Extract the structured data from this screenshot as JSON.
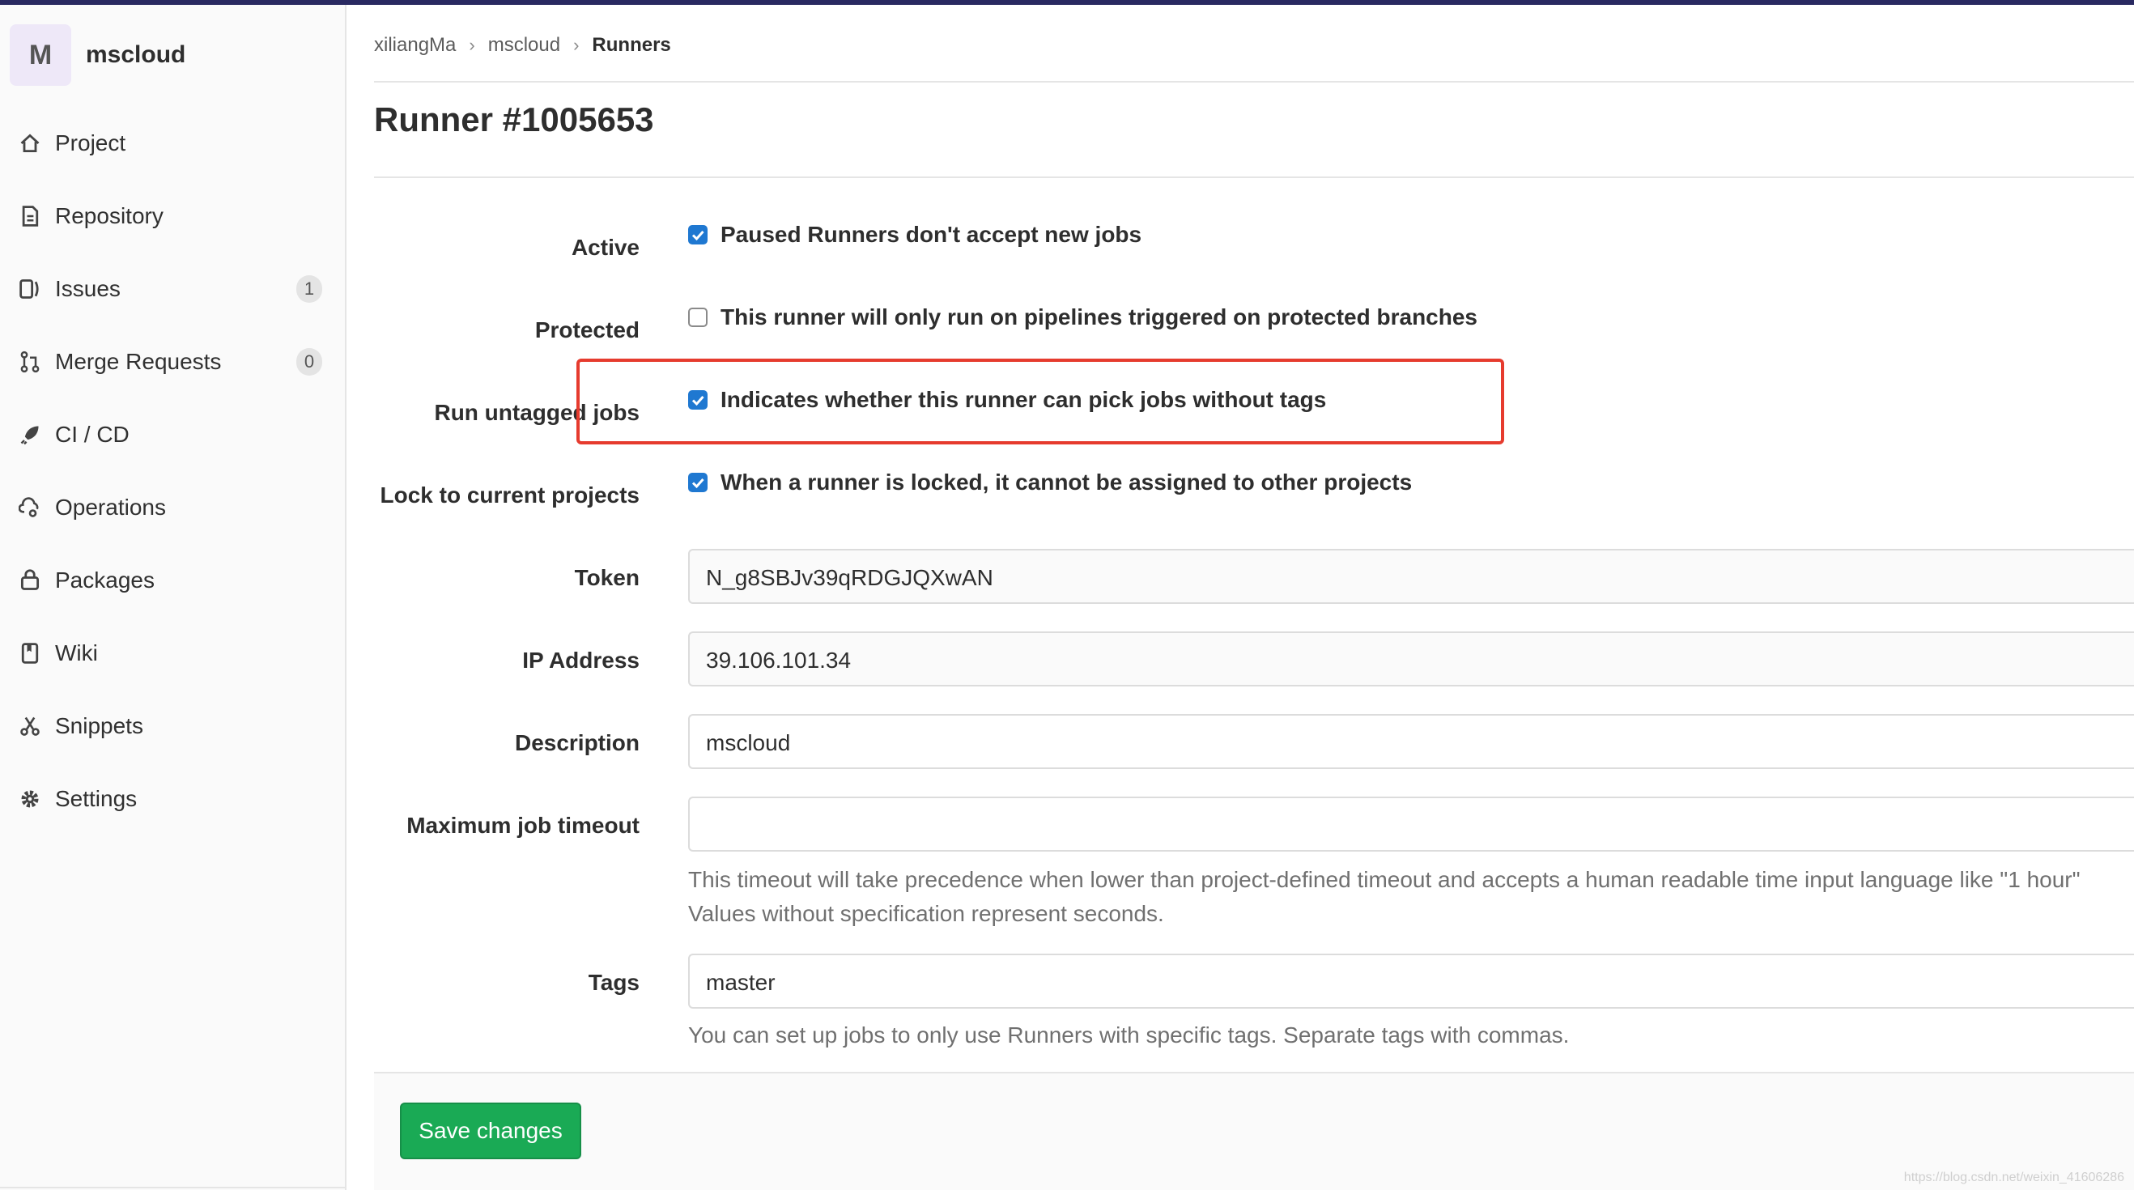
{
  "sidebar": {
    "avatar_letter": "M",
    "project_name": "mscloud",
    "items": [
      {
        "label": "Project",
        "icon": "home-icon"
      },
      {
        "label": "Repository",
        "icon": "doc-icon"
      },
      {
        "label": "Issues",
        "icon": "issues-icon",
        "badge": "1"
      },
      {
        "label": "Merge Requests",
        "icon": "merge-icon",
        "badge": "0"
      },
      {
        "label": "CI / CD",
        "icon": "rocket-icon"
      },
      {
        "label": "Operations",
        "icon": "cloud-gear-icon"
      },
      {
        "label": "Packages",
        "icon": "package-icon"
      },
      {
        "label": "Wiki",
        "icon": "book-icon"
      },
      {
        "label": "Snippets",
        "icon": "scissors-icon"
      },
      {
        "label": "Settings",
        "icon": "gear-icon"
      }
    ]
  },
  "breadcrumb": {
    "items": [
      "xiliangMa",
      "mscloud",
      "Runners"
    ],
    "separator": "›"
  },
  "page": {
    "title": "Runner #1005653"
  },
  "form": {
    "active": {
      "label": "Active",
      "text": "Paused Runners don't accept new jobs",
      "checked": true
    },
    "protected": {
      "label": "Protected",
      "text": "This runner will only run on pipelines triggered on protected branches",
      "checked": false
    },
    "run_untagged": {
      "label": "Run untagged jobs",
      "text": "Indicates whether this runner can pick jobs without tags",
      "checked": true
    },
    "lock": {
      "label": "Lock to current projects",
      "text": "When a runner is locked, it cannot be assigned to other projects",
      "checked": true
    },
    "token": {
      "label": "Token",
      "value": "N_g8SBJv39qRDGJQXwAN"
    },
    "ip": {
      "label": "IP Address",
      "value": "39.106.101.34"
    },
    "description": {
      "label": "Description",
      "value": "mscloud"
    },
    "timeout": {
      "label": "Maximum job timeout",
      "value": "",
      "help_line1": "This timeout will take precedence when lower than project-defined timeout and accepts a human readable time input language like \"1 hour\"",
      "help_line2": "Values without specification represent seconds."
    },
    "tags": {
      "label": "Tags",
      "value": "master",
      "help": "You can set up jobs to only use Runners with specific tags. Separate tags with commas."
    },
    "save_label": "Save changes"
  },
  "watermark": "https://blog.csdn.net/weixin_41606286",
  "colors": {
    "accent": "#1f78d1",
    "save": "#1aaa55",
    "highlight": "#e63b2e",
    "topbar": "#292961"
  }
}
